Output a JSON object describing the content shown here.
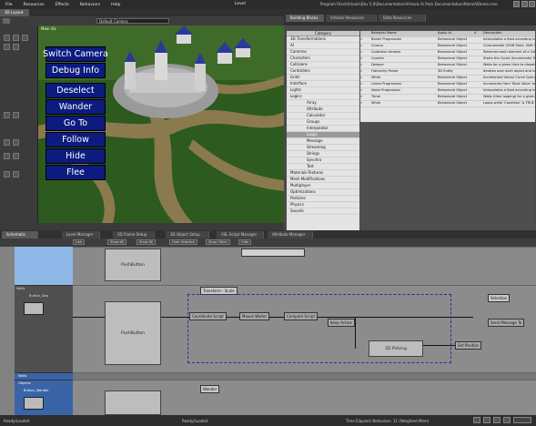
{
  "menu": {
    "items": [
      "File",
      "Resources",
      "Effects",
      "Behaviors",
      "Help"
    ],
    "title": "Level",
    "path": "Program Files\\Virtools\\Dev 5.0\\Documentation\\Virtools Ai Pack Documentation\\PatrolAiDemo.cmo"
  },
  "viewport": {
    "tab": "3D Layout",
    "camera_select": "Default Camera",
    "label": "Main Vis",
    "sim_buttons": [
      "Switch Camera",
      "Debug Info",
      "Deselect",
      "Wander",
      "Go To",
      "Follow",
      "Hide",
      "Flee"
    ]
  },
  "building_blocks": {
    "tabs": [
      "Building Blocks",
      "Virtools Resources",
      "Data Resources"
    ],
    "category_header": "Category",
    "categories": [
      {
        "label": "3D Transformations",
        "sub": false,
        "sel": false
      },
      {
        "label": "AI",
        "sub": false,
        "sel": false
      },
      {
        "label": "Cameras",
        "sub": false,
        "sel": false
      },
      {
        "label": "Characters",
        "sub": false,
        "sel": false
      },
      {
        "label": "Collisions",
        "sub": false,
        "sel": false
      },
      {
        "label": "Controllers",
        "sub": false,
        "sel": false
      },
      {
        "label": "Grids",
        "sub": false,
        "sel": false
      },
      {
        "label": "Interface",
        "sub": false,
        "sel": false
      },
      {
        "label": "Lights",
        "sub": false,
        "sel": false
      },
      {
        "label": "Logics",
        "sub": false,
        "sel": false
      },
      {
        "label": "Array",
        "sub": true,
        "sel": false
      },
      {
        "label": "Attribute",
        "sub": true,
        "sel": false
      },
      {
        "label": "Calculator",
        "sub": true,
        "sel": false
      },
      {
        "label": "Groups",
        "sub": true,
        "sel": false
      },
      {
        "label": "Interpolator",
        "sub": true,
        "sel": false
      },
      {
        "label": "Loops",
        "sub": true,
        "sel": true
      },
      {
        "label": "Message",
        "sub": true,
        "sel": false
      },
      {
        "label": "Streaming",
        "sub": true,
        "sel": false
      },
      {
        "label": "Strings",
        "sub": true,
        "sel": false
      },
      {
        "label": "Synchro",
        "sub": true,
        "sel": false
      },
      {
        "label": "Test",
        "sub": true,
        "sel": false
      },
      {
        "label": "Materials-Textures",
        "sub": false,
        "sel": false
      },
      {
        "label": "Mesh Modifications",
        "sub": false,
        "sel": false
      },
      {
        "label": "Multiplayer",
        "sub": false,
        "sel": false
      },
      {
        "label": "Optimizations",
        "sub": false,
        "sel": false
      },
      {
        "label": "Particles",
        "sub": false,
        "sel": false
      },
      {
        "label": "Physics",
        "sub": false,
        "sel": false
      },
      {
        "label": "Sounds",
        "sub": false,
        "sel": false
      }
    ],
    "columns": [
      "Behavior Name",
      "Apply to",
      "V",
      "Description"
    ],
    "rows": [
      [
        "Bezier Progression",
        "Behavioral Object",
        "",
        "Interpolates a float according to a Bezier"
      ],
      [
        "Chrono",
        "Behavioral Object",
        "",
        "Chronometer (Shift Start, Shift Stop)"
      ],
      [
        "Collection Iterator",
        "Behavioral Object",
        "",
        "Retrieves each element of a Collection"
      ],
      [
        "Counter",
        "Behavioral Object",
        "",
        "Starts the Count (increments) from 'Start'"
      ],
      [
        "Delayer",
        "Behavioral Object",
        "",
        "Waits for a given time to dispatch activation"
      ],
      [
        "Hierarchy Parser",
        "3D Entity",
        "",
        "Iterates over each object and sub-object"
      ],
      [
        "While",
        "Behavioral Object",
        "",
        "Incremental Vector Curve Query Iteration"
      ],
      [
        "Linear Progression",
        "Behavioral Object",
        "",
        "Increments from 'Start Value' to 'End Value'"
      ],
      [
        "Noise Progression",
        "Behavioral Object",
        "",
        "Interpolates a float according to a Noise"
      ],
      [
        "Timer",
        "Behavioral Object",
        "",
        "Waits (time looping) for a given time"
      ],
      [
        "While",
        "Behavioral Object",
        "",
        "Loops while 'Condition' is TRUE"
      ]
    ]
  },
  "schematic": {
    "tabs": [
      "Schematic",
      "Level Manager",
      "3D Frame Setup",
      "3D Object Setup",
      "VSL Script Manager",
      "Attribute Manager"
    ],
    "toolbar": [
      "Link",
      "Show All",
      "Show All",
      "Hide Selected",
      "Show Other",
      "Hide"
    ],
    "lanes": [
      "Walls",
      "Button_Dea",
      "Walls",
      "Objects",
      "Button_Wander"
    ],
    "blocks": {
      "pushbutton": "PushButton",
      "coord": "Coordinate Script",
      "mouse": "Mouse Waiter",
      "compare": "Compare Script",
      "keep": "Keep Active",
      "picking": "2D Picking",
      "setpos": "Set Position",
      "send": "Send Message To",
      "transform": "Transform - Scale",
      "selection": "Selection",
      "wander": "Wander"
    }
  },
  "status": {
    "left": "Ready/Loaded",
    "mid": "Ready/Loaded",
    "right": "Time Elapsed: Behaviors: 11 (Weighted Mem)"
  }
}
